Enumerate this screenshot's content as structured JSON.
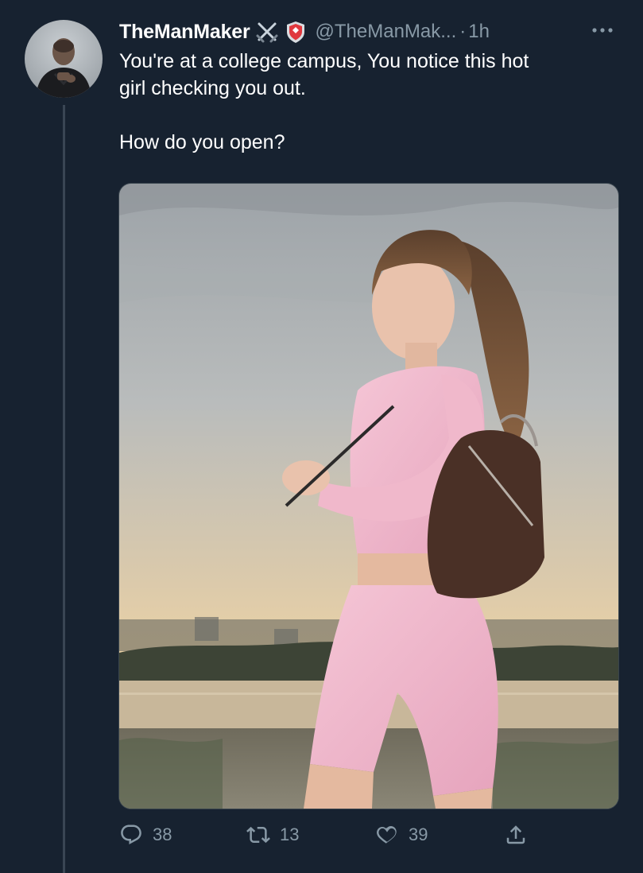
{
  "author": {
    "display_name": "TheManMaker",
    "handle": "@TheManMak...",
    "separator": "·",
    "timestamp": "1h",
    "avatar_icon": "profile-avatar",
    "badges": [
      "crossed-swords-icon",
      "shield-icon"
    ]
  },
  "tweet": {
    "line1": "You're at a college campus, You notice this hot",
    "line2": "girl checking you out.",
    "line3": "How do you open?"
  },
  "media": {
    "icon": "photo-attachment"
  },
  "actions": {
    "reply_count": "38",
    "retweet_count": "13",
    "like_count": "39"
  },
  "colors": {
    "background": "#172230",
    "text_primary": "#ffffff",
    "text_secondary": "#8899a6",
    "thread_line": "#3a4654"
  }
}
